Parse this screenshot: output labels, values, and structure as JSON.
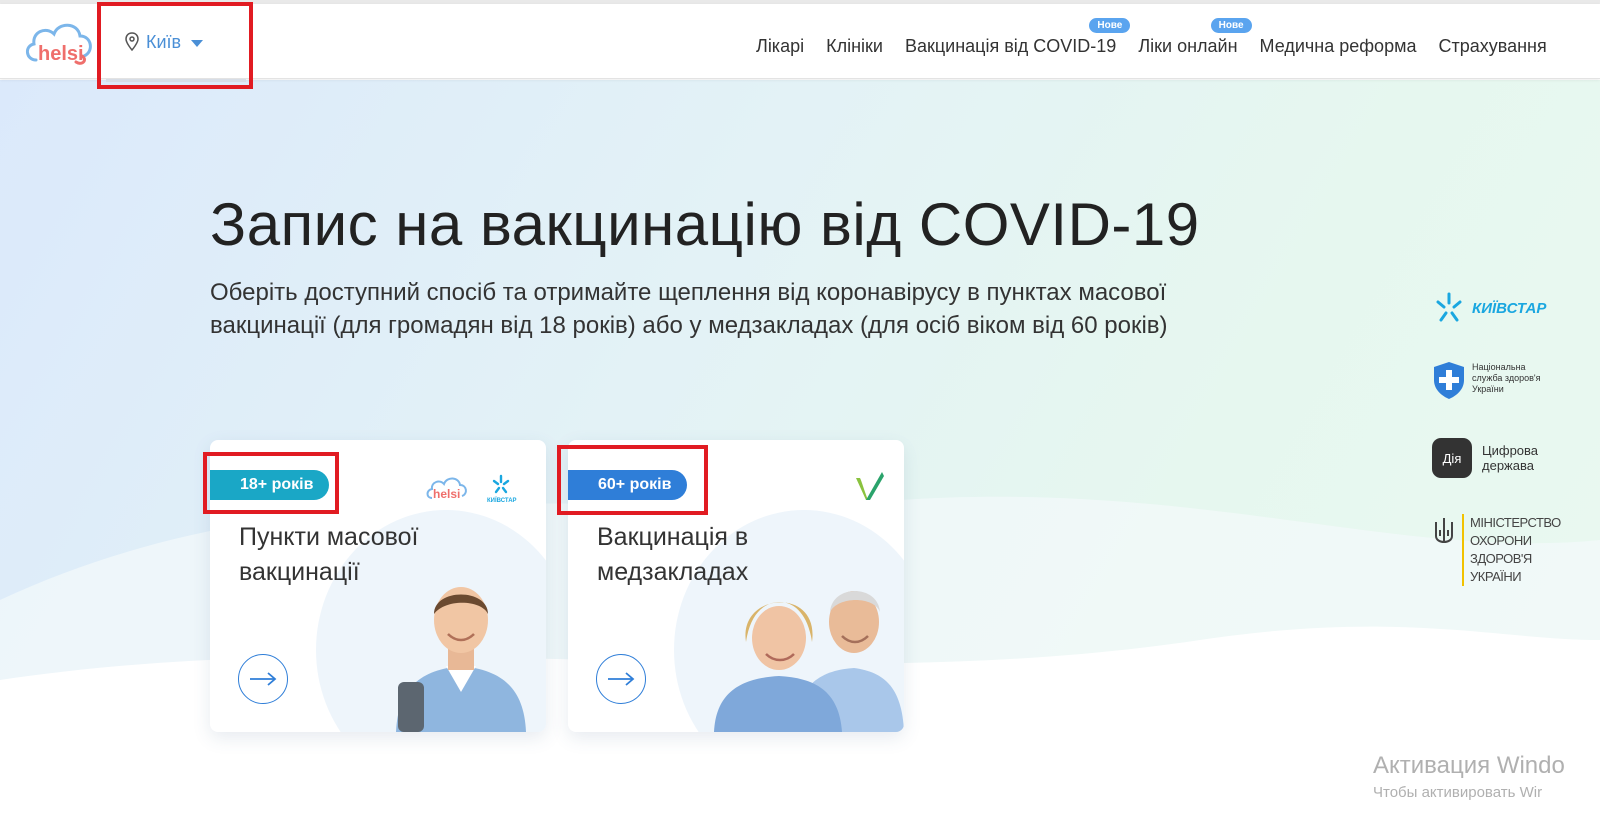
{
  "header": {
    "logo_text": "helsi",
    "city": "Київ",
    "nav": [
      {
        "label": "Лікарі",
        "badge": ""
      },
      {
        "label": "Клініки",
        "badge": ""
      },
      {
        "label": "Вакцинація від COVID-19",
        "badge": "Нове"
      },
      {
        "label": "Ліки онлайн",
        "badge": "Нове"
      },
      {
        "label": "Медична реформа",
        "badge": ""
      },
      {
        "label": "Страхування",
        "badge": ""
      }
    ]
  },
  "hero": {
    "title": "Запис на вакцинацію від COVID-19",
    "subtitle": "Оберіть доступний спосіб та отримайте щеплення від коронавірусу в пунктах масової вакцинації (для громадян від 18 років) або у медзакладах (для осіб віком від 60 років)"
  },
  "cards": [
    {
      "tag": "18+ років",
      "title": "Пункти масової вакцинації",
      "partner_logo_helsi": "helsi",
      "partner_logo_kyivstar": "КИЇВСТАР"
    },
    {
      "tag": "60+ років",
      "title": "Вакцинація в медзакладах"
    }
  ],
  "partners": {
    "kyivstar": "КИЇВСТАР",
    "nszu": [
      "Національна",
      "служба здоров'я",
      "України"
    ],
    "diia_icon": "Дія",
    "diia_text": [
      "Цифрова",
      "держава"
    ],
    "moz": [
      "МІНІСТЕРСТВО",
      "ОХОРОНИ",
      "ЗДОРОВ'Я",
      "УКРАЇНИ"
    ]
  },
  "overlay": {
    "line1": "Активация Windo",
    "line2": "Чтобы активировать Wir"
  },
  "colors": {
    "accent": "#4a8fd6",
    "badge": "#5aa4ef",
    "tag_18": "#1aa7c6",
    "tag_60": "#2f7ed8",
    "highlight": "#e11b22"
  }
}
